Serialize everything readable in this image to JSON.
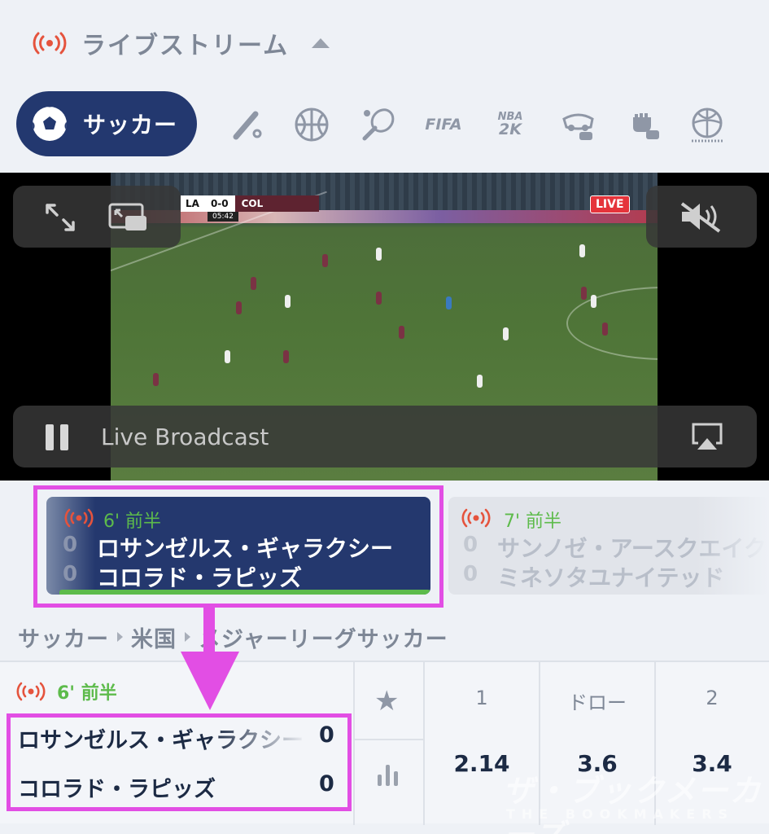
{
  "header": {
    "title": "ライブストリーム"
  },
  "sports": {
    "active_label": "サッカー",
    "icons": [
      "baseball-icon",
      "basketball-icon",
      "tennis-icon",
      "fifa-icon",
      "nba2k-icon",
      "racing-esports-icon",
      "fighting-esports-icon",
      "volleyball-icon"
    ],
    "fifa_text": "FIFA",
    "nba_text": "NBA",
    "nba_sub": "2K"
  },
  "video": {
    "scorebug_home": "LA",
    "scorebug_score": "0-0",
    "scorebug_away": "COL",
    "scorebug_time": "05:42",
    "live_tag": "LIVE",
    "status_label": "Live Broadcast"
  },
  "events": [
    {
      "time": "6' 前半",
      "home_score": "0",
      "away_score": "0",
      "home": "ロサンゼルス・ギャラクシー",
      "away": "コロラド・ラピッズ"
    },
    {
      "time": "7' 前半",
      "home_score": "0",
      "away_score": "0",
      "home": "サンノゼ・アースクエイクス",
      "away": "ミネソタユナイテッド"
    }
  ],
  "breadcrumb": [
    "サッカー",
    "米国",
    "メジャーリーグサッカー"
  ],
  "market": {
    "time": "6' 前半",
    "home": "ロサンゼルス・ギャラクシー",
    "away": "コロラド・ラピッズ",
    "home_score": "0",
    "away_score": "0",
    "odds": [
      {
        "label": "1",
        "value": "2.14"
      },
      {
        "label": "ドロー",
        "value": "3.6"
      },
      {
        "label": "2",
        "value": "3.4"
      }
    ]
  },
  "watermark": {
    "main": "ザ・ブックメーカーズ",
    "sub": "THE BOOKMAKERS"
  },
  "colors": {
    "navy": "#23386f",
    "live_red": "#e5533d",
    "live_green": "#5dbb4b",
    "highlight": "#e24ee4"
  }
}
